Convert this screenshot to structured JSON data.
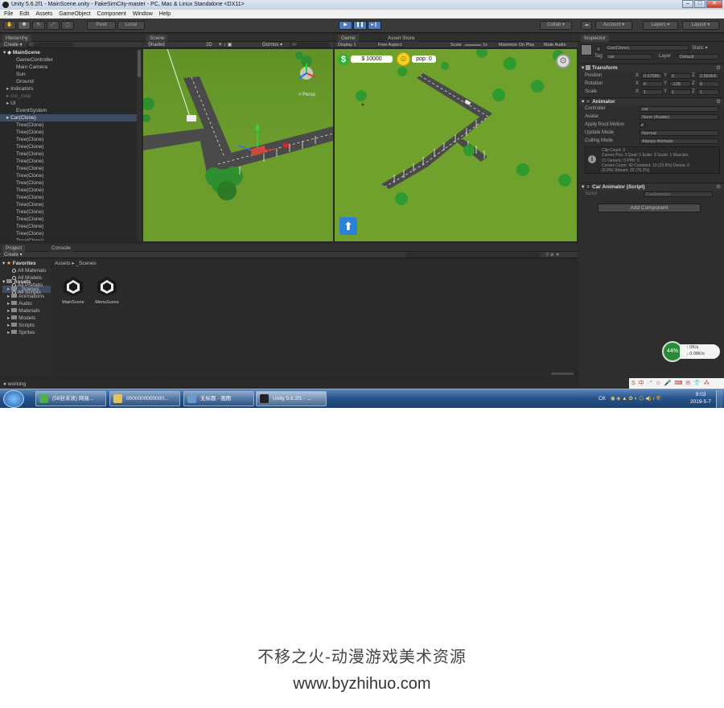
{
  "window": {
    "title": "Unity 5.6.2f1 - MainScene.unity - FakeSimCity-master - PC, Mac & Linux Standalone <DX11>"
  },
  "menu": [
    "File",
    "Edit",
    "Assets",
    "GameObject",
    "Component",
    "Window",
    "Help"
  ],
  "toolbar": {
    "pivot": "Pivot",
    "local": "Local",
    "collab": "Collab ▾",
    "account": "Account ▾",
    "layers": "Layers ▾",
    "layout": "Layout ▾"
  },
  "hierarchy": {
    "tab": "Hierarchy",
    "create": "Create ▾",
    "search_placeholder": "All",
    "scene": "MainScene",
    "items": [
      {
        "label": "GameController",
        "indent": 1
      },
      {
        "label": "Main Camera",
        "indent": 1
      },
      {
        "label": "Sun",
        "indent": 1
      },
      {
        "label": "Ground",
        "indent": 1
      },
      {
        "label": "Indicators",
        "indent": 1,
        "arrow": true
      },
      {
        "label": "out_map",
        "indent": 1,
        "arrow": true,
        "dim": true
      },
      {
        "label": "UI",
        "indent": 1,
        "arrow": true
      },
      {
        "label": "EventSystem",
        "indent": 1
      },
      {
        "label": "Car(Clone)",
        "indent": 1,
        "arrow": true,
        "selected": true
      },
      {
        "label": "Tree(Clone)",
        "indent": 1
      },
      {
        "label": "Tree(Clone)",
        "indent": 1
      },
      {
        "label": "Tree(Clone)",
        "indent": 1
      },
      {
        "label": "Tree(Clone)",
        "indent": 1
      },
      {
        "label": "Tree(Clone)",
        "indent": 1
      },
      {
        "label": "Tree(Clone)",
        "indent": 1
      },
      {
        "label": "Tree(Clone)",
        "indent": 1
      },
      {
        "label": "Tree(Clone)",
        "indent": 1
      },
      {
        "label": "Tree(Clone)",
        "indent": 1
      },
      {
        "label": "Tree(Clone)",
        "indent": 1
      },
      {
        "label": "Tree(Clone)",
        "indent": 1
      },
      {
        "label": "Tree(Clone)",
        "indent": 1
      },
      {
        "label": "Tree(Clone)",
        "indent": 1
      },
      {
        "label": "Tree(Clone)",
        "indent": 1
      },
      {
        "label": "Tree(Clone)",
        "indent": 1
      },
      {
        "label": "Tree(Clone)",
        "indent": 1
      },
      {
        "label": "Tree(Clone)",
        "indent": 1
      }
    ]
  },
  "scene": {
    "tab": "Scene",
    "shading": "Shaded",
    "mode": "2D",
    "gizmos": "Gizmos ▾",
    "search": "All",
    "persp": "< Persp"
  },
  "game": {
    "tab": "Game",
    "store_tab": "Asset Store",
    "display": "Display 1",
    "aspect": "Free Aspect",
    "scale": "Scale",
    "scale_val": "1x",
    "maximize": "Maximize On Play",
    "mute": "Mute Audio",
    "money": "$ 10000",
    "pop": "pop: 0"
  },
  "inspector": {
    "tab": "Inspector",
    "object_name": "Car(Clone)",
    "static": "Static ▾",
    "tag_label": "Tag",
    "tag": "car",
    "layer_label": "Layer",
    "layer": "Default",
    "transform": {
      "title": "Transform",
      "rows": [
        {
          "label": "Position",
          "x": "0.67586",
          "y": "0",
          "z": "2.85964"
        },
        {
          "label": "Rotation",
          "x": "0",
          "y": "-135",
          "z": "0"
        },
        {
          "label": "Scale",
          "x": "1",
          "y": "1",
          "z": "1"
        }
      ]
    },
    "animator": {
      "title": "Animator",
      "rows": [
        {
          "label": "Controller",
          "value": "car"
        },
        {
          "label": "Avatar",
          "value": "None (Avatar)"
        },
        {
          "label": "Apply Root Motion",
          "value": "✓"
        },
        {
          "label": "Update Mode",
          "value": "Normal"
        },
        {
          "label": "Culling Mode",
          "value": "Always Animate"
        }
      ],
      "info": [
        "Clip Count: 3",
        "Curves Pos: 3 Quat: 0 Euler: 3 Scale: 1 Muscles:",
        "21 Generic: 0 PPtr: 0",
        "Curves Count: 42 Constant: 10 (23.8%) Dense: 0",
        "(0.0%) Stream: 32 (76.2%)"
      ]
    },
    "script": {
      "title": "Car Animator (Script)",
      "label": "Script",
      "value": "CarAnimator"
    },
    "add_component": "Add Component"
  },
  "project": {
    "tab_project": "Project",
    "tab_console": "Console",
    "create": "Create ▾",
    "breadcrumb": [
      "Assets",
      "_Scenes"
    ],
    "favorites": {
      "title": "Favorites",
      "items": [
        "All Materials",
        "All Models",
        "All Prefabs",
        "All Scripts"
      ]
    },
    "assets": {
      "title": "Assets",
      "items": [
        "_Scenes",
        "Animations",
        "Audio",
        "Materials",
        "Models",
        "Scripts",
        "Sprites"
      ]
    },
    "files": [
      "MainScene",
      "MenuScene"
    ]
  },
  "status": {
    "text": "working"
  },
  "network": {
    "percent": "44%",
    "up": "0K/s",
    "down": "0.08K/s"
  },
  "taskbar": {
    "tasks": [
      {
        "label": "(58封未读) 网易...",
        "color": "#4caf50"
      },
      {
        "label": "0000000000000...",
        "color": "#e6c35a"
      },
      {
        "label": "无标题 - 画图",
        "color": "#6a9bd0"
      },
      {
        "label": "Unity 5.6.2f1 - ...",
        "color": "#222"
      }
    ],
    "lang": "CK",
    "time": "9:03",
    "date": "2019-5-7"
  },
  "watermark": {
    "line1": "不移之火-动漫游戏美术资源",
    "line2": "www.byzhihuo.com"
  },
  "colors": {
    "grass": "#6fa12e",
    "road": "#4a4a4a",
    "tree": "#2f8f2f",
    "accent": "#3e4c61"
  }
}
